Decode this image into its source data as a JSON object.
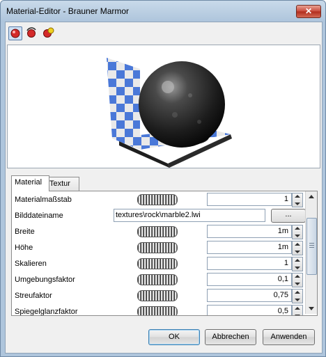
{
  "window": {
    "title": "Material-Editor - Brauner Marmor"
  },
  "toolbar": {
    "icons": [
      "material-ball-red-icon",
      "material-ball-refresh-icon",
      "material-ball-yellow-icon"
    ]
  },
  "tabs": [
    {
      "label": "Material"
    },
    {
      "label": "Textur"
    }
  ],
  "properties": {
    "materialmassstab": {
      "label": "Materialmaßstab",
      "value": "1"
    },
    "bilddateiname": {
      "label": "Bilddateiname",
      "value": "textures\\rock\\marble2.lwi",
      "browse": "..."
    },
    "breite": {
      "label": "Breite",
      "value": "1m"
    },
    "hoehe": {
      "label": "Höhe",
      "value": "1m"
    },
    "skalieren": {
      "label": "Skalieren",
      "value": "1"
    },
    "umgebungsfaktor": {
      "label": "Umgebungsfaktor",
      "value": "0,1"
    },
    "streufaktor": {
      "label": "Streufaktor",
      "value": "0,75"
    },
    "spiegelglanzfaktor": {
      "label": "Spiegelglanzfaktor",
      "value": "0,5"
    }
  },
  "buttons": {
    "ok": "OK",
    "cancel": "Abbrechen",
    "apply": "Anwenden"
  },
  "colors": {
    "checker_blue": "#4a78d8",
    "close_red": "#c8483a"
  }
}
